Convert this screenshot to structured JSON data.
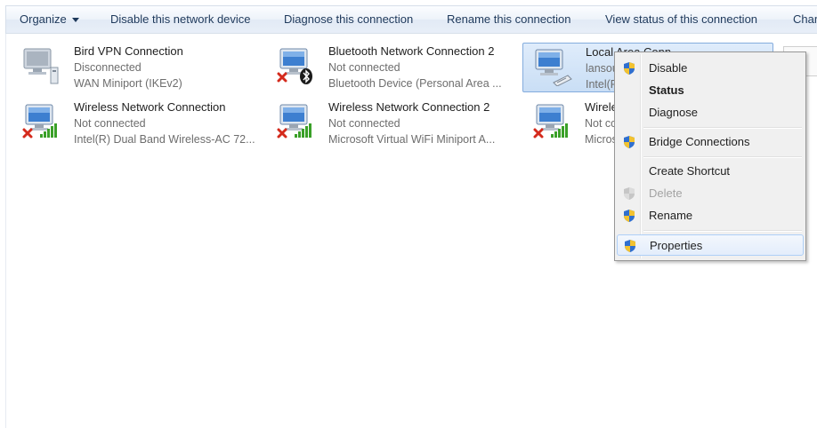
{
  "toolbar": {
    "organize": "Organize",
    "disable": "Disable this network device",
    "diagnose": "Diagnose this connection",
    "rename": "Rename this connection",
    "view_status": "View status of this connection",
    "change": "Char"
  },
  "connections": [
    {
      "name": "Bird VPN Connection",
      "status": "Disconnected",
      "device": "WAN Miniport (IKEv2)",
      "icon": "vpn-icon"
    },
    {
      "name": "Bluetooth Network Connection 2",
      "status": "Not connected",
      "device": "Bluetooth Device (Personal Area ...",
      "icon": "bluetooth-icon"
    },
    {
      "name": "Local Area Connection",
      "status": "lansou",
      "device": "Intel(R",
      "icon": "ethernet-icon"
    },
    {
      "name": "Wireless Network Connection",
      "status": "Not connected",
      "device": "Intel(R) Dual Band Wireless-AC 72...",
      "icon": "wireless-icon"
    },
    {
      "name": "Wireless Network Connection 2",
      "status": "Not connected",
      "device": "Microsoft Virtual WiFi Miniport A...",
      "icon": "wireless-icon"
    },
    {
      "name": "Wirele",
      "status": "Not co",
      "device": "Micros",
      "icon": "wireless-icon"
    }
  ],
  "context_menu": {
    "disable": "Disable",
    "status": "Status",
    "diagnose": "Diagnose",
    "bridge": "Bridge Connections",
    "create_shortcut": "Create Shortcut",
    "delete": "Delete",
    "rename": "Rename",
    "properties": "Properties"
  },
  "colors": {
    "toolbar_text": "#1e395b",
    "selection": "#cce0f7",
    "disconnected_x": "#d42a1c",
    "signal_green": "#3aa028"
  }
}
